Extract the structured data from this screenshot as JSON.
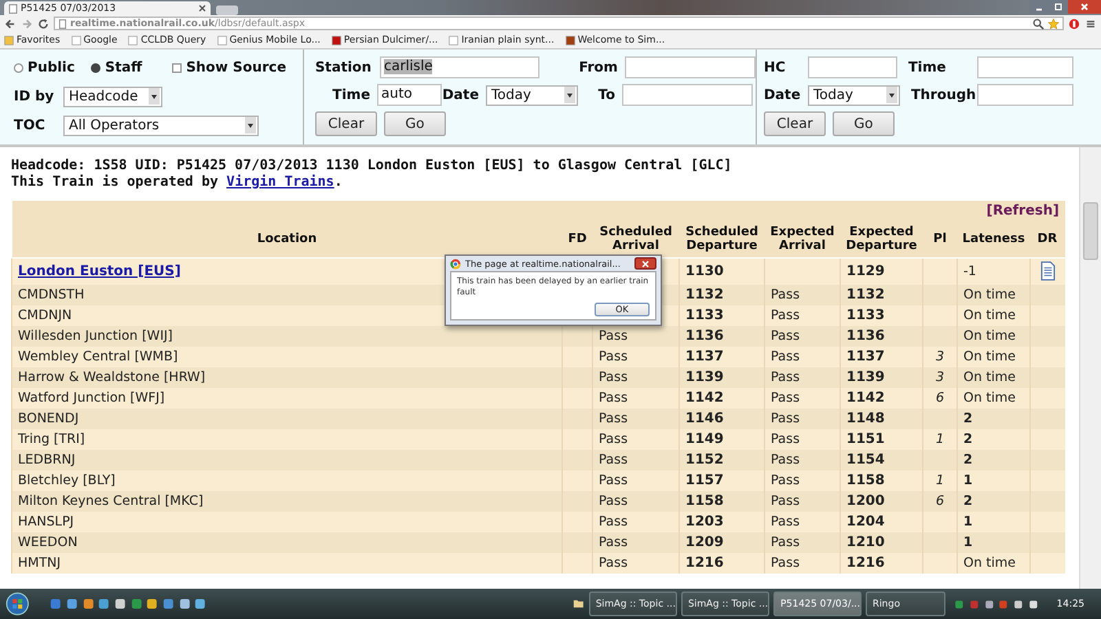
{
  "browser": {
    "tab_title": "P51425 07/03/2013",
    "url": "**realtime.nationalrail.co.uk**/ldbsr/default.aspx",
    "bookmarks": [
      "Favorites",
      "Google",
      "CCLDB Query",
      "Genius Mobile Lo...",
      "Persian Dulcimer/...",
      "Iranian plain synt...",
      "Welcome to Sim..."
    ]
  },
  "search": {
    "modes": [
      {
        "label": "Public",
        "selected": false
      },
      {
        "label": "Staff",
        "selected": true
      }
    ],
    "show_source": {
      "label": "Show Source",
      "checked": false
    },
    "id_by": {
      "label": "ID by",
      "value": "Headcode"
    },
    "toc": {
      "label": "TOC",
      "value": "All Operators"
    },
    "station": {
      "label": "Station",
      "value": "carlisle"
    },
    "from": {
      "label": "From"
    },
    "time": {
      "label": "Time",
      "value": "auto"
    },
    "date": {
      "label": "Date",
      "value": "Today"
    },
    "to": {
      "label": "To"
    },
    "station_buttons": [
      "Clear",
      "Go"
    ],
    "hc": {
      "label": "HC"
    },
    "hc_time": {
      "label": "Time"
    },
    "hc_date": {
      "label": "Date",
      "value": "Today"
    },
    "through": {
      "label": "Through"
    },
    "hc_buttons": [
      "Clear",
      "Go"
    ]
  },
  "heading": {
    "title": "Headcode: 1S58 UID: P51425 07/03/2013 1130 London Euston [EUS] to Glasgow Central [GLC]",
    "operated_by": "This Train is operated by",
    "operator": "Virgin Trains",
    "end": "."
  },
  "table": {
    "refresh": "[Refresh]",
    "columns": [
      "Location",
      "FD",
      "Scheduled Arrival",
      "Scheduled Departure",
      "Expected Arrival",
      "Expected Departure",
      "Pl",
      "Lateness",
      "DR"
    ],
    "rows": [
      {
        "location": "London Euston [EUS]",
        "link": true,
        "sched_dep": "1130",
        "exp_dep": "1129",
        "lateness": "-1",
        "late": false,
        "document": true
      },
      {
        "location": "CMDNSTH",
        "link": false,
        "sched_dep": "1132",
        "exp_arr": "Pass",
        "exp_dep": "1132",
        "lateness": "On time",
        "late": false,
        "document": false
      },
      {
        "location": "CMDNJN",
        "link": false,
        "sched_dep": "1133",
        "exp_arr": "Pass",
        "exp_dep": "1133",
        "lateness": "On time",
        "late": false,
        "document": false
      },
      {
        "location": "Willesden Junction [WIJ]",
        "link": false,
        "sched_arr": "Pass",
        "sched_dep": "1136",
        "exp_arr": "Pass",
        "exp_dep": "1136",
        "lateness": "On time",
        "late": false,
        "document": false
      },
      {
        "location": "Wembley Central [WMB]",
        "link": false,
        "sched_arr": "Pass",
        "sched_dep": "1137",
        "exp_arr": "Pass",
        "exp_dep": "1137",
        "platform": "3",
        "lateness": "On time",
        "late": false,
        "document": false
      },
      {
        "location": "Harrow & Wealdstone [HRW]",
        "link": false,
        "sched_arr": "Pass",
        "sched_dep": "1139",
        "exp_arr": "Pass",
        "exp_dep": "1139",
        "platform": "3",
        "lateness": "On time",
        "late": false,
        "document": false
      },
      {
        "location": "Watford Junction [WFJ]",
        "link": false,
        "sched_arr": "Pass",
        "sched_dep": "1142",
        "exp_arr": "Pass",
        "exp_dep": "1142",
        "platform": "6",
        "lateness": "On time",
        "late": false,
        "document": false
      },
      {
        "location": "BONENDJ",
        "link": false,
        "sched_arr": "Pass",
        "sched_dep": "1146",
        "exp_arr": "Pass",
        "exp_dep": "1148",
        "lateness": "2",
        "late": true,
        "document": false
      },
      {
        "location": "Tring [TRI]",
        "link": false,
        "sched_arr": "Pass",
        "sched_dep": "1149",
        "exp_arr": "Pass",
        "exp_dep": "1151",
        "platform": "1",
        "lateness": "2",
        "late": true,
        "document": false
      },
      {
        "location": "LEDBRNJ",
        "link": false,
        "sched_arr": "Pass",
        "sched_dep": "1152",
        "exp_arr": "Pass",
        "exp_dep": "1154",
        "lateness": "2",
        "late": true,
        "document": false
      },
      {
        "location": "Bletchley [BLY]",
        "link": false,
        "sched_arr": "Pass",
        "sched_dep": "1157",
        "exp_arr": "Pass",
        "exp_dep": "1158",
        "platform": "1",
        "lateness": "1",
        "late": true,
        "document": false
      },
      {
        "location": "Milton Keynes Central [MKC]",
        "link": false,
        "sched_arr": "Pass",
        "sched_dep": "1158",
        "exp_arr": "Pass",
        "exp_dep": "1200",
        "platform": "6",
        "lateness": "2",
        "late": true,
        "document": false
      },
      {
        "location": "HANSLPJ",
        "link": false,
        "sched_arr": "Pass",
        "sched_dep": "1203",
        "exp_arr": "Pass",
        "exp_dep": "1204",
        "lateness": "1",
        "late": true,
        "document": false
      },
      {
        "location": "WEEDON",
        "link": false,
        "sched_arr": "Pass",
        "sched_dep": "1209",
        "exp_arr": "Pass",
        "exp_dep": "1210",
        "lateness": "1",
        "late": true,
        "document": false
      },
      {
        "location": "HMTNJ",
        "link": false,
        "sched_arr": "Pass",
        "sched_dep": "1216",
        "exp_arr": "Pass",
        "exp_dep": "1216",
        "lateness": "On time",
        "late": false,
        "document": false
      }
    ]
  },
  "dialog": {
    "title": "The page at realtime.nationalrail...",
    "message": "This train has been delayed by an earlier train fault",
    "button": "OK"
  },
  "taskbar": {
    "windows": [
      {
        "label": "SimAg :: Topic ...",
        "selected": false
      },
      {
        "label": "SimAg :: Topic ...",
        "selected": false
      },
      {
        "label": "P51425 07/03/...",
        "selected": true
      },
      {
        "label": "Ringo",
        "selected": false
      }
    ],
    "clock": "14:25"
  }
}
